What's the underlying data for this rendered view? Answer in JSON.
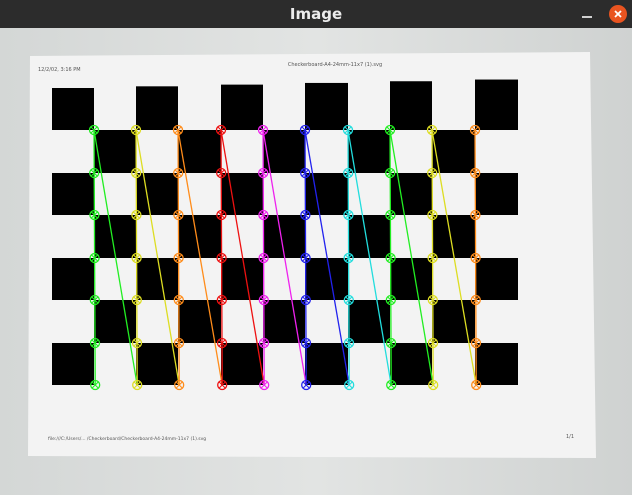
{
  "window": {
    "title": "Image"
  },
  "paper": {
    "header_left": "12/2/02, 3:16 PM",
    "header_center": "Checkerboard-A4-24mm-11x7 (1).svg",
    "footer_left": "file:///C:/Users/... /Checkerboard/Checkerboard-A4-24mm-11x7 (1).svg",
    "footer_right": "1/1"
  },
  "board": {
    "columns": 11,
    "rows": 7,
    "corner_grid": "10 x 7",
    "detection_colors": [
      "#22ee22",
      "#dddd22",
      "#ff8c1a",
      "#ee1111",
      "#ee22ee",
      "#2222ee",
      "#22dddd",
      "#22ee22",
      "#dddd22",
      "#ff8c1a",
      "#ee1111"
    ]
  }
}
